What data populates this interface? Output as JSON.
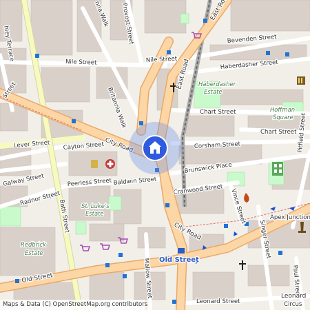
{
  "map": {
    "roads": {
      "east_road": "East Road",
      "city_road": "City Road",
      "old_street": "Old Street",
      "bath_street": "Bath Street",
      "nile_street": "Nile Street",
      "nile_street_2": "Nile Street",
      "provost_street": "Provost Street",
      "bevenden_street": "Bevenden Street",
      "haberdasher_street": "Haberdasher Street",
      "chart_street": "Chart Street",
      "chart_street_2": "Chart Street",
      "corsham_street": "Corsham Street",
      "brunswick_place": "Brunswick Place",
      "cranwood_street": "Cranwood Street",
      "baldwin_street": "Baldwin Street",
      "peerless_street": "Peerless Street",
      "cayton_street": "Cayton Street",
      "lever_street": "Lever Street",
      "galway_street": "Galway Street",
      "radnor_street": "Radnor Street",
      "britannia_walk": "Britannia Walk",
      "anna_walk": "nna Walk",
      "vince_street": "Vince Street",
      "singer_street": "Singer Street",
      "pitfield_street": "Pitfield Street",
      "mallow_street": "Mallow Street",
      "paul_street": "Paul Street",
      "leonard_street": "Leonard Street",
      "leonard_partial": "Leonard",
      "city_road_2": "City Road",
      "ashley_terrace": "hley Terrace",
      "street_partial": "Street",
      "apex_junction": "Apex Junction",
      "circus_partial": "Circus"
    },
    "areas": {
      "haberdasher_estate": [
        "Haberdasher",
        "Estate"
      ],
      "hoffman_square": [
        "Hoffman",
        "Square"
      ],
      "st_lukes_estate": [
        "St. Luke's",
        "Estate"
      ],
      "redbrick_estate": [
        "Redbrick",
        "Estate"
      ]
    },
    "station": "Old Street",
    "location_marker": "home-location-marker"
  },
  "attribution": "Maps & Data (C) OpenStreetMap.org contributors",
  "colors": {
    "background": "#f2efe9",
    "building": "#d9d0c9",
    "major_road": "#fcd6a4",
    "major_road_casing": "#e9a96b",
    "secondary_road": "#f7fabf",
    "minor_road": "#ffffff",
    "park": "#c8facc",
    "railway": "#777777",
    "bus_stop": "#1f73d6",
    "marker_halo": "#6a8fe8",
    "marker_core": "#2f5bde"
  }
}
